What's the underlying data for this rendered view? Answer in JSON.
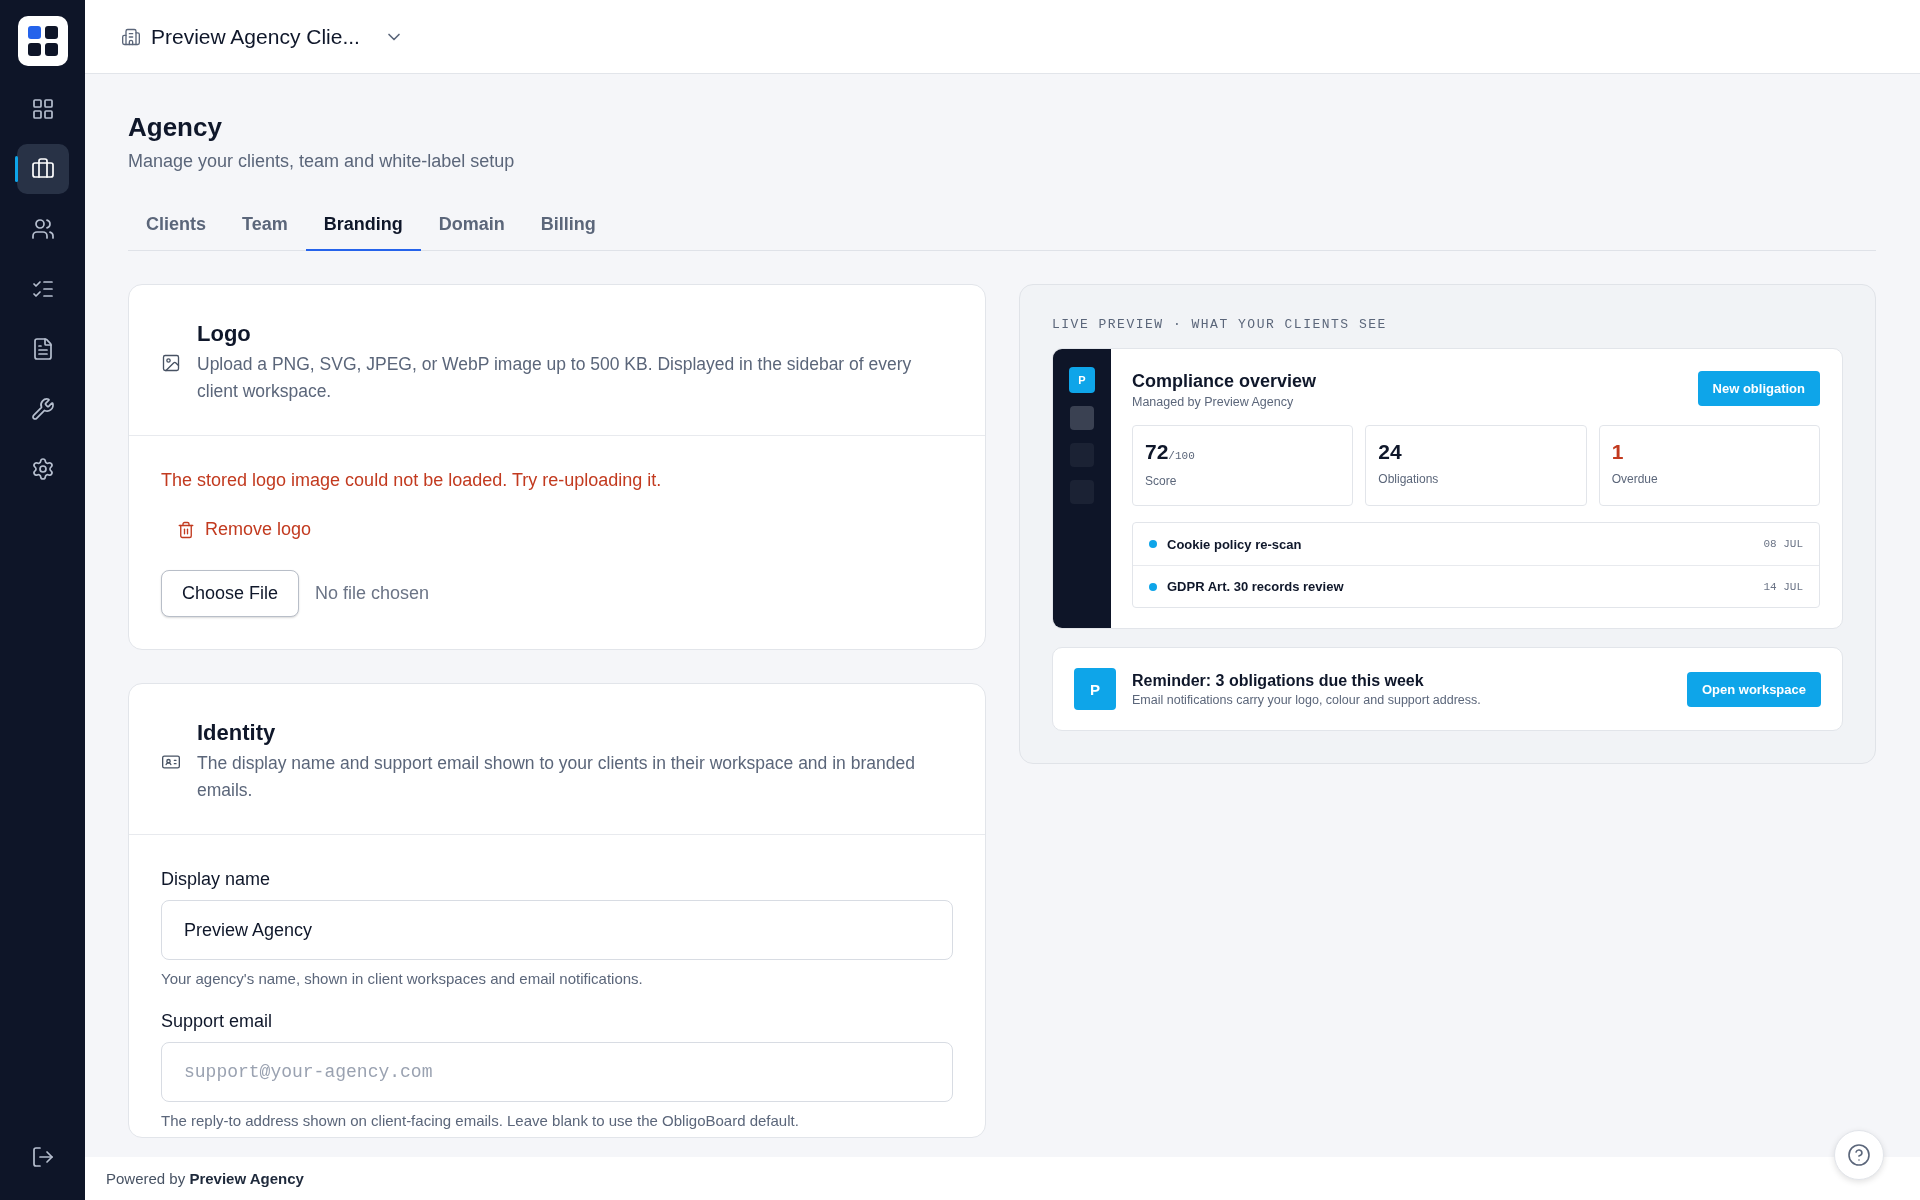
{
  "sidebar": {
    "items": [
      {
        "kind": "dashboard",
        "selected": false
      },
      {
        "kind": "briefcase",
        "selected": true
      },
      {
        "kind": "users",
        "selected": false
      },
      {
        "kind": "checklist",
        "selected": false
      },
      {
        "kind": "document",
        "selected": false
      },
      {
        "kind": "wrench",
        "selected": false
      },
      {
        "kind": "settings",
        "selected": false
      }
    ]
  },
  "header": {
    "workspace": "Preview Agency Clie..."
  },
  "page": {
    "title": "Agency",
    "subtitle": "Manage your clients, team and white-label setup"
  },
  "tabs": [
    {
      "label": "Clients",
      "selected": false
    },
    {
      "label": "Team",
      "selected": false
    },
    {
      "label": "Branding",
      "selected": true
    },
    {
      "label": "Domain",
      "selected": false
    },
    {
      "label": "Billing",
      "selected": false
    }
  ],
  "logo_card": {
    "title": "Logo",
    "description": "Upload a PNG, SVG, JPEG, or WebP image up to 500 KB. Displayed in the sidebar of every client workspace.",
    "error": "The stored logo image could not be loaded. Try re-uploading it.",
    "remove_label": "Remove logo",
    "file_button": "Choose File",
    "file_status": "No file chosen"
  },
  "identity_card": {
    "title": "Identity",
    "description": "The display name and support email shown to your clients in their workspace and in branded emails.",
    "fields": [
      {
        "label": "Display name",
        "value": "Preview Agency",
        "hint": "Your agency's name, shown in client workspaces and email notifications."
      },
      {
        "label": "Support email",
        "placeholder": "support@your-agency.com",
        "hint": "The reply-to address shown on client-facing emails. Leave blank to use the ObligoBoard default."
      }
    ]
  },
  "preview": {
    "label": "LIVE PREVIEW · WHAT YOUR CLIENTS SEE",
    "badge": "P",
    "nav": [
      {
        "selected": true
      },
      {
        "selected": false
      },
      {
        "selected": false
      }
    ],
    "title": "Compliance overview",
    "subtitle": "Managed by Preview Agency",
    "button": "New obligation",
    "stats": [
      {
        "value": "72",
        "suffix": "/100",
        "label": "Score",
        "alert": false
      },
      {
        "value": "24",
        "label": "Obligations",
        "alert": false
      },
      {
        "value": "1",
        "label": "Overdue",
        "alert": true
      }
    ],
    "tasks": [
      {
        "title": "Cookie policy re-scan",
        "date": "08 JUL",
        "color": "#0ea5e9"
      },
      {
        "title": "GDPR Art. 30 records review",
        "date": "14 JUL",
        "color": "#0ea5e9"
      }
    ],
    "email": {
      "badge": "P",
      "title": "Reminder: 3 obligations due this week",
      "text": "Email notifications carry your logo, colour and support address.",
      "button": "Open workspace"
    }
  },
  "footer": {
    "text": "Powered by **Preview Agency**"
  }
}
